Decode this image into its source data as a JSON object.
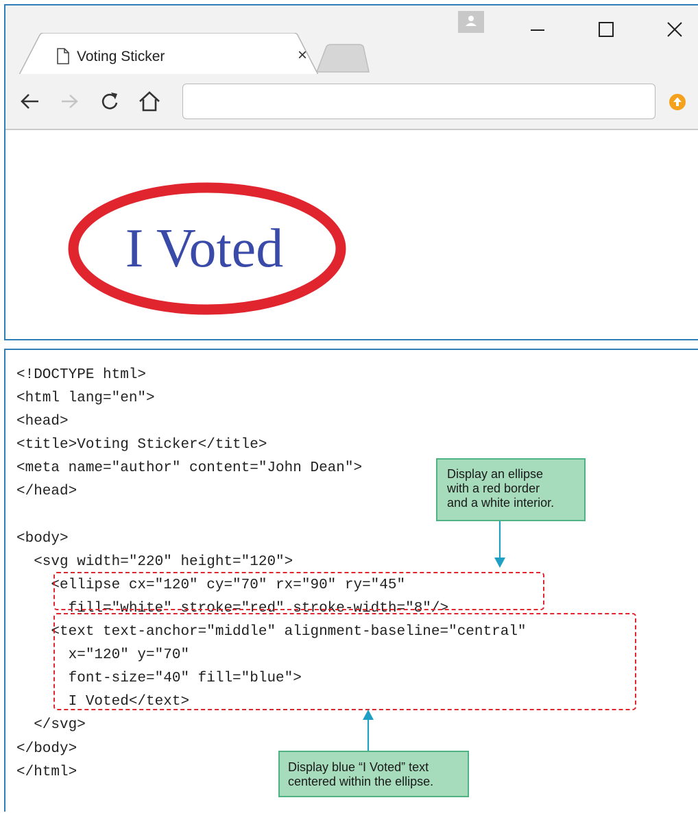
{
  "browser": {
    "tab": {
      "title": "Voting Sticker"
    },
    "address_bar": {
      "value": ""
    }
  },
  "page": {
    "sticker_text": "I Voted",
    "colors": {
      "ellipse_stroke": "#e0252f",
      "text": "#3a4aa8"
    }
  },
  "code": {
    "lines": [
      "<!DOCTYPE html>",
      "<html lang=\"en\">",
      "<head>",
      "<title>Voting Sticker</title>",
      "<meta name=\"author\" content=\"John Dean\">",
      "</head>",
      "",
      "<body>",
      "  <svg width=\"220\" height=\"120\">",
      "    <ellipse cx=\"120\" cy=\"70\" rx=\"90\" ry=\"45\"",
      "      fill=\"white\" stroke=\"red\" stroke-width=\"8\"/>",
      "    <text text-anchor=\"middle\" alignment-baseline=\"central\"",
      "      x=\"120\" y=\"70\"",
      "      font-size=\"40\" fill=\"blue\">",
      "      I Voted</text>",
      "  </svg>",
      "</body>",
      "</html>"
    ]
  },
  "callouts": {
    "ellipse": [
      "Display an ellipse",
      "with a red border",
      "and a white interior."
    ],
    "text": [
      "Display blue “I Voted” text",
      "centered within the ellipse."
    ]
  }
}
